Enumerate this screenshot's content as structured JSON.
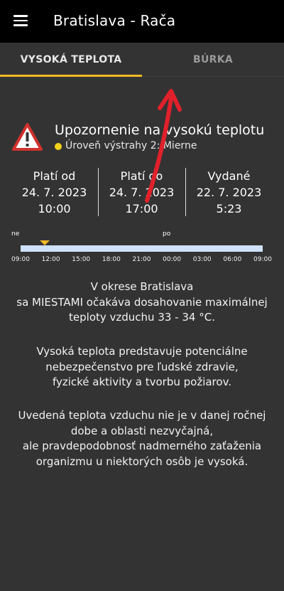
{
  "appbar": {
    "title": "Bratislava - Rača",
    "menu_icon": "hamburger-menu-icon"
  },
  "tabs": [
    {
      "label": "VYSOKÁ TEPLOTA",
      "active": true
    },
    {
      "label": "BÚRKA",
      "active": false
    }
  ],
  "colors": {
    "accent": "#f2b827",
    "background": "#333333",
    "appbar": "#000000",
    "warning_red": "#d0312d",
    "timeline": "#cfe2fa",
    "annotation_arrow": "#e0212b"
  },
  "warning": {
    "icon": "warning-triangle-icon",
    "title": "Upozornenie na vysokú teplotu",
    "level_text": "Úroveň výstrahy 2: Mierne",
    "level_color": "#f2d21b"
  },
  "validity": [
    {
      "label": "Platí od",
      "date": "24. 7. 2023",
      "time": "10:00"
    },
    {
      "label": "Platí do",
      "date": "24. 7. 2023",
      "time": "17:00"
    },
    {
      "label": "Vydané",
      "date": "22. 7. 2023",
      "time": "5:23"
    }
  ],
  "timeline": {
    "day_labels": [
      "ne",
      "po"
    ],
    "ticks": [
      "09:00",
      "12:00",
      "15:00",
      "18:00",
      "21:00",
      "00:00",
      "03:00",
      "06:00",
      "09:00"
    ],
    "marker_time": "12:00"
  },
  "description": {
    "p1": [
      "V okrese Bratislava",
      "sa MIESTAMI očakáva dosahovanie maximálnej",
      "teploty vzduchu 33 - 34 °C."
    ],
    "p2": [
      "Vysoká teplota predstavuje potenciálne",
      "nebezpečenstvo pre ľudské zdravie,",
      "fyzické aktivity a tvorbu požiarov."
    ],
    "p3": [
      "Uvedená teplota vzduchu nie je v danej ročnej",
      "dobe a oblasti nezvyčajná,",
      "ale pravdepodobnosť nadmerného zaťaženia",
      "organizmu u niektorých osôb je vysoká."
    ]
  }
}
